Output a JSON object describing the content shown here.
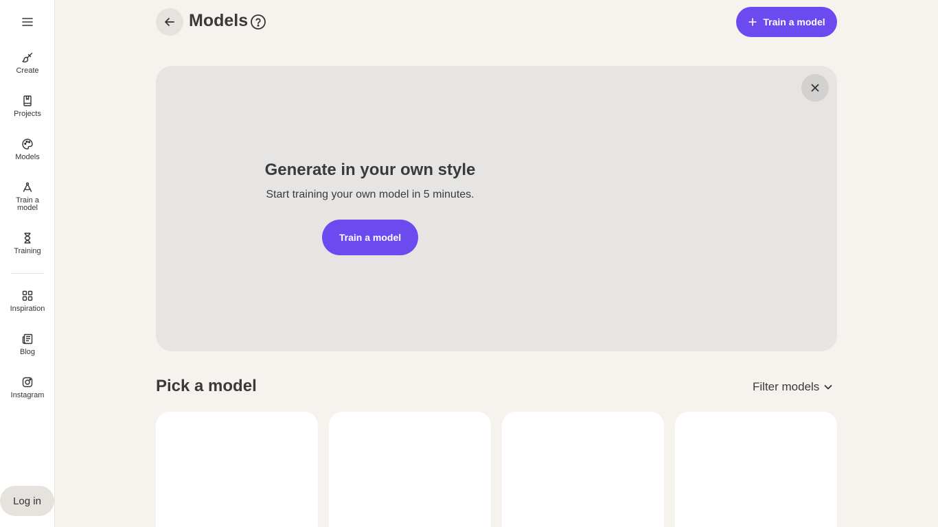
{
  "sidebar": {
    "menu_icon": "hamburger-icon",
    "items": [
      {
        "label": "Create",
        "icon": "paintbrush-icon"
      },
      {
        "label": "Projects",
        "icon": "book-icon"
      },
      {
        "label": "Models",
        "icon": "palette-icon"
      },
      {
        "label": "Train a model",
        "icon": "compass-drawing-icon"
      },
      {
        "label": "Training",
        "icon": "hourglass-icon"
      },
      {
        "label": "Inspiration",
        "icon": "grid-icon"
      },
      {
        "label": "Blog",
        "icon": "newspaper-icon"
      },
      {
        "label": "Instagram",
        "icon": "instagram-icon"
      }
    ],
    "login_label": "Log in"
  },
  "header": {
    "title": "Models",
    "train_button_label": "Train a model"
  },
  "promo": {
    "heading": "Generate in your own style",
    "subtitle": "Start training your own model in 5 minutes.",
    "button_label": "Train a model"
  },
  "models_section": {
    "title": "Pick a model",
    "filter_label": "Filter models"
  },
  "colors": {
    "accent": "#6b4bf0",
    "background": "#f6f3ef",
    "card": "#e6e5e4"
  }
}
